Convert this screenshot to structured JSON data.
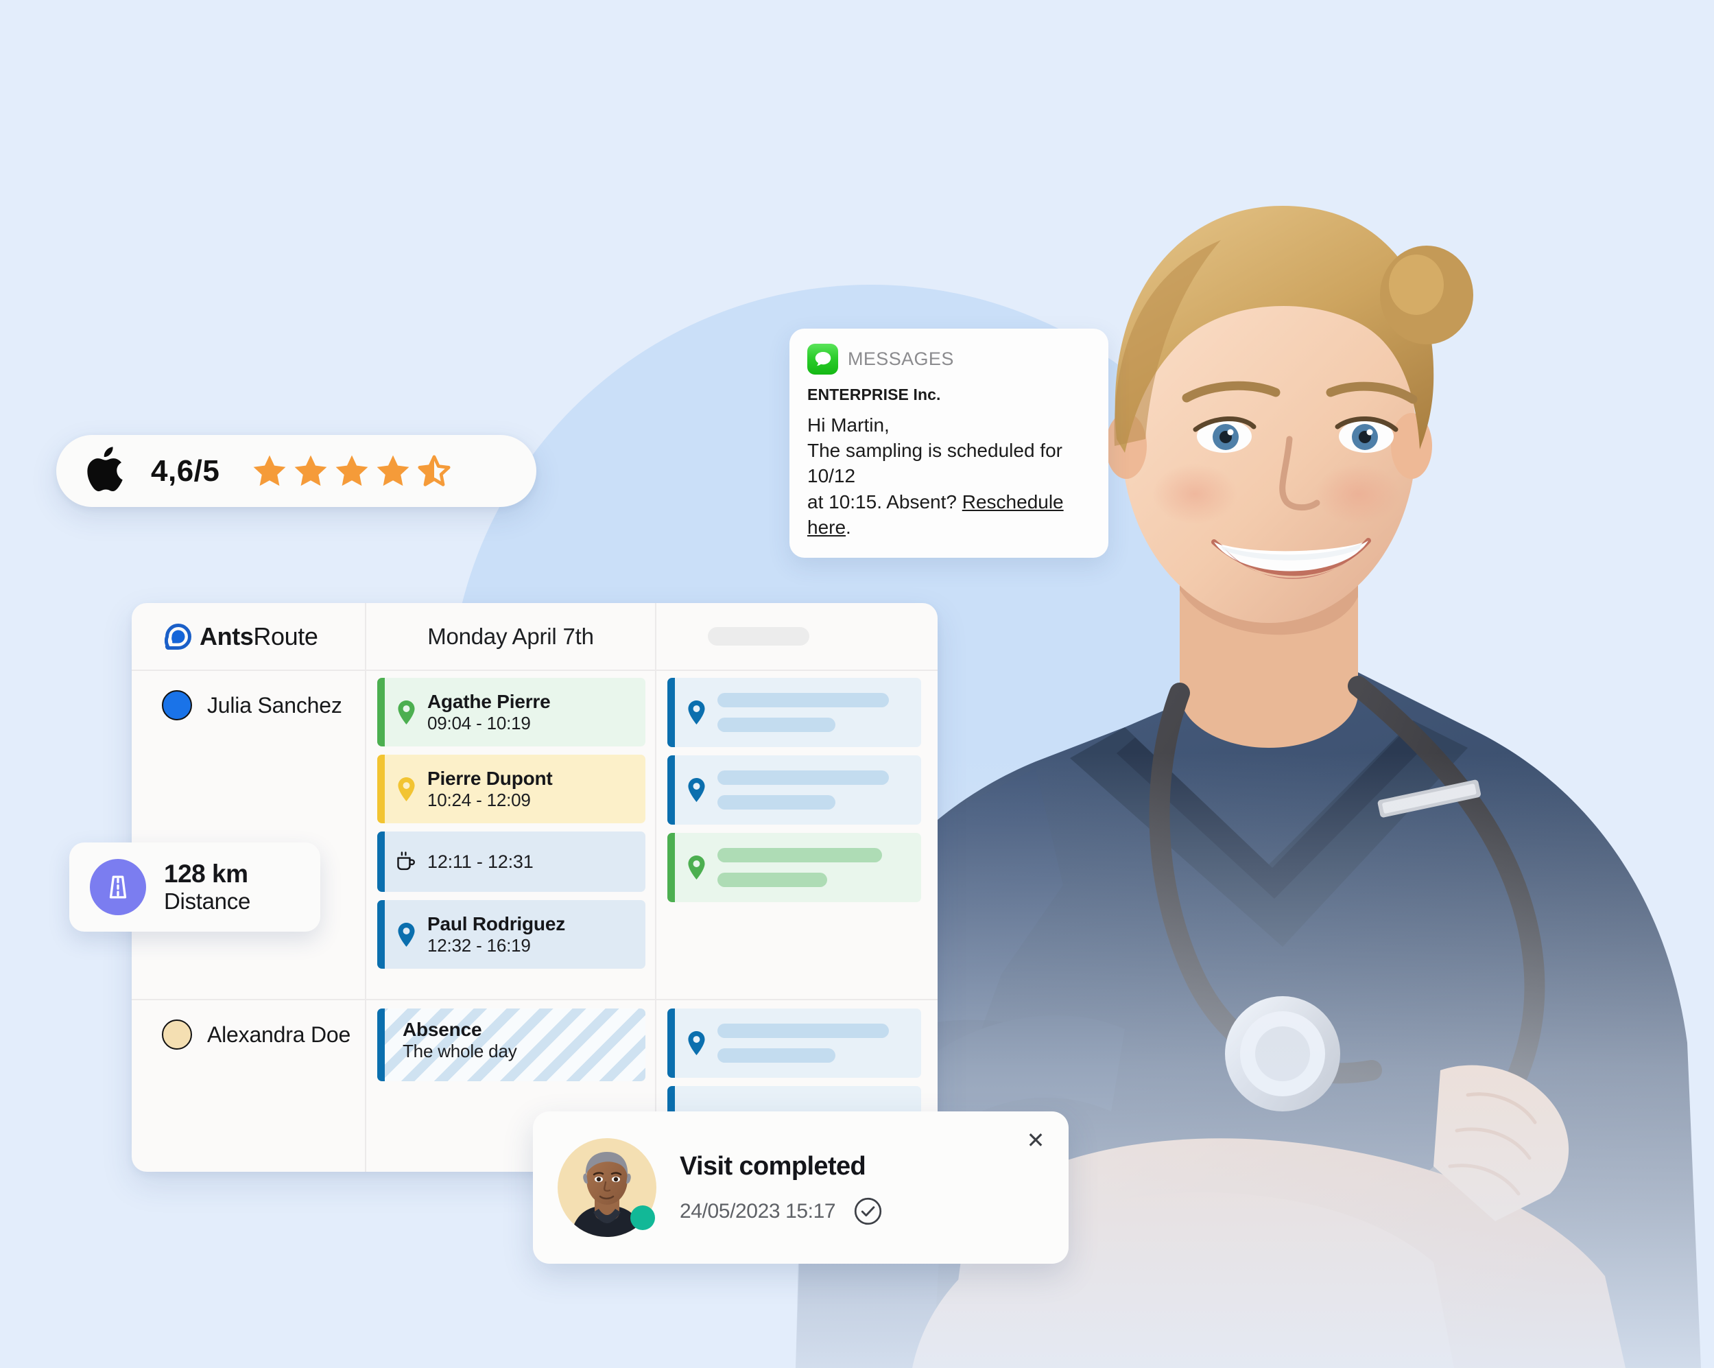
{
  "theme": {
    "background": "#e3edfb",
    "decor_circle": "#c6dcf7",
    "accent_blue": "#0b6fae",
    "accent_green": "#4caf50",
    "accent_yellow": "#f2c432",
    "star_orange": "#f59b39",
    "purple": "#7b7df0",
    "teal_status": "#12b897"
  },
  "rating_pill": {
    "platform_icon": "apple-icon",
    "value": "4,6/5",
    "stars_filled": 4,
    "stars_half": 1,
    "stars_total": 5
  },
  "message_notification": {
    "app_icon": "messages-app-icon",
    "app_name": "MESSAGES",
    "sender": "ENTERPRISE Inc.",
    "greeting": "Hi Martin,",
    "line_1": "The sampling is scheduled for 10/12",
    "line_2_prefix": "at 10:15. Absent? ",
    "link_text": "Reschedule here",
    "line_2_suffix": "."
  },
  "scheduler": {
    "logo": {
      "icon": "antsroute-logo-icon",
      "bold": "Ants",
      "light": "Route"
    },
    "date_label": "Monday April 7th",
    "header_placeholder": "",
    "drivers": [
      {
        "name": "Julia Sanchez",
        "color": "#1a73e8"
      },
      {
        "name": "Alexandra Doe",
        "color": "#f4dfb2"
      }
    ],
    "appointments": [
      {
        "type": "visit",
        "icon": "map-pin-icon",
        "title": "Agathe Pierre",
        "time": "09:04 - 10:19",
        "color": "green"
      },
      {
        "type": "visit",
        "icon": "map-pin-icon",
        "title": "Pierre Dupont",
        "time": "10:24 - 12:09",
        "color": "yellow"
      },
      {
        "type": "break",
        "icon": "coffee-cup-icon",
        "title": "",
        "time": "12:11 - 12:31",
        "color": "blue"
      },
      {
        "type": "visit",
        "icon": "map-pin-icon",
        "title": "Paul Rodriguez",
        "time": "12:32 - 16:19",
        "color": "blue"
      }
    ],
    "absence": {
      "title": "Absence",
      "subtitle": "The whole day",
      "icon": "absence-stripe-pattern"
    },
    "skeleton_rows": [
      {
        "color": "blue",
        "icon": "map-pin-icon"
      },
      {
        "color": "blue",
        "icon": "map-pin-icon"
      },
      {
        "color": "green",
        "icon": "map-pin-icon"
      },
      {
        "color": "blue",
        "icon": "map-pin-icon"
      },
      {
        "color": "blue",
        "icon": "map-pin-icon"
      }
    ]
  },
  "distance_chip": {
    "icon": "road-icon",
    "value": "128 km",
    "label": "Distance"
  },
  "visit_toast": {
    "avatar_icon": "user-avatar",
    "status": "online",
    "title": "Visit completed",
    "detail_placeholder": "",
    "timestamp": "24/05/2023 15:17",
    "check_icon": "check-circle-icon",
    "close_icon": "close-icon",
    "close_label": "✕"
  }
}
